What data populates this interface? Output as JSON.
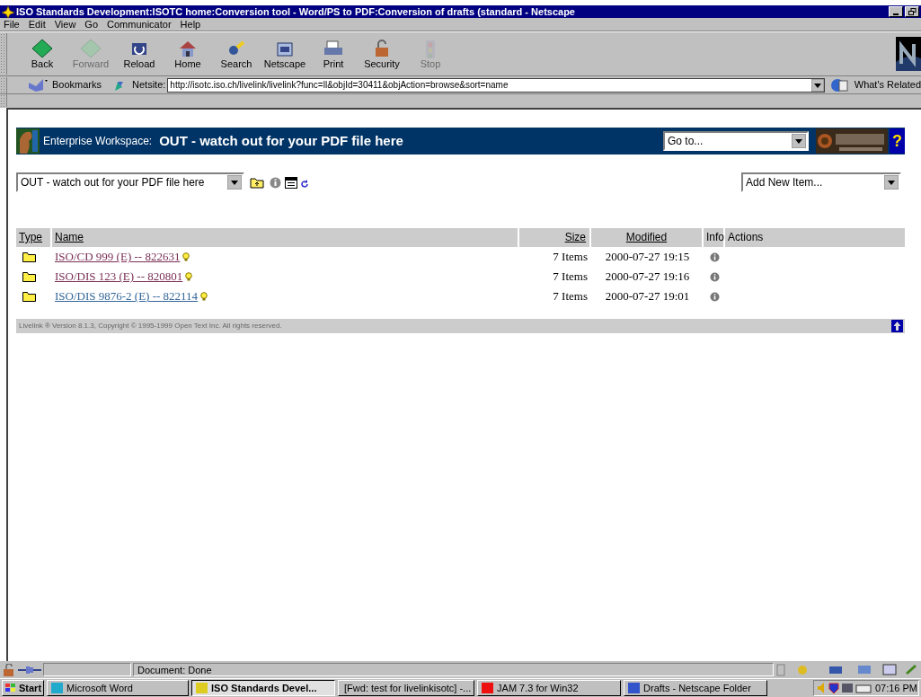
{
  "window": {
    "title": "ISO Standards Development:ISOTC home:Conversion tool - Word/PS to PDF:Conversion of drafts (standard - Netscape"
  },
  "menu": [
    "File",
    "Edit",
    "View",
    "Go",
    "Communicator",
    "Help"
  ],
  "toolbar": [
    {
      "label": "Back",
      "disabled": false
    },
    {
      "label": "Forward",
      "disabled": true
    },
    {
      "label": "Reload",
      "disabled": false
    },
    {
      "label": "Home",
      "disabled": false
    },
    {
      "label": "Search",
      "disabled": false
    },
    {
      "label": "Netscape",
      "disabled": false
    },
    {
      "label": "Print",
      "disabled": false
    },
    {
      "label": "Security",
      "disabled": false
    },
    {
      "label": "Stop",
      "disabled": true
    }
  ],
  "location_bar": {
    "bookmarks": "Bookmarks",
    "label": "Netsite:",
    "url": "http://isotc.iso.ch/livelink/livelink?func=ll&objId=30411&objAction=browse&sort=name",
    "related": "What's Related"
  },
  "page": {
    "workspace_label": "Enterprise Workspace:",
    "folder_title": "OUT - watch out for your PDF file here",
    "goto": "Go to...",
    "help": "?",
    "folder_select": "OUT - watch out for your PDF file here",
    "add_item": "Add New Item...",
    "table": {
      "columns": [
        "Type",
        "Name",
        "Size",
        "Modified",
        "Info",
        "Actions"
      ],
      "rows": [
        {
          "name": "ISO/CD 999 (E) -- 822631",
          "visited": true,
          "size": "7 Items",
          "modified": "2000-07-27 19:15"
        },
        {
          "name": "ISO/DIS 123 (E) -- 820801",
          "visited": true,
          "size": "7 Items",
          "modified": "2000-07-27 19:16"
        },
        {
          "name": "ISO/DIS 9876-2 (E) -- 822114",
          "visited": false,
          "size": "7 Items",
          "modified": "2000-07-27 19:01"
        }
      ]
    },
    "footer": "Livelink ® Version 8.1.3, Copyright © 1995-1999 Open Text Inc. All rights reserved."
  },
  "status_bar": {
    "text": "Document: Done"
  },
  "taskbar": {
    "start": "Start",
    "items": [
      {
        "label": "Microsoft Word",
        "selected": false
      },
      {
        "label": "ISO Standards Devel...",
        "selected": true
      },
      {
        "label": "[Fwd: test for livelinkisotc] -...",
        "selected": false
      },
      {
        "label": "JAM 7.3 for Win32",
        "selected": false
      },
      {
        "label": "Drafts - Netscape Folder",
        "selected": false
      }
    ],
    "clock": "07:16 PM"
  }
}
